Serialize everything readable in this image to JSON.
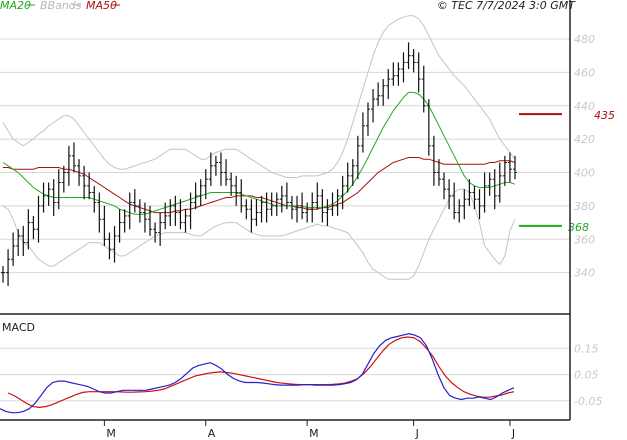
{
  "header": {
    "legend": [
      {
        "label": "MA20",
        "color": "#22aa22"
      },
      {
        "label": "BBands",
        "color": "#b8b8b8"
      },
      {
        "label": "MA50",
        "color": "#aa1111"
      }
    ],
    "source": "© TEC 7/7/2024 3:0 GMT"
  },
  "colors": {
    "price": "#111111",
    "ma20": "#22aa22",
    "ma50": "#aa1111",
    "bbands": "#c4c4c4",
    "macd": "#2222cc",
    "signal": "#cc1111",
    "grid": "#d8d8d8",
    "ytick": "#c8c8c8"
  },
  "chart_data": [
    {
      "type": "line",
      "name": "price",
      "ylim": [
        320,
        495
      ],
      "y_ticks": [
        340,
        360,
        380,
        400,
        420,
        440,
        460,
        480
      ],
      "x_labels": [
        "M",
        "A",
        "M",
        "J",
        "J"
      ],
      "x_label_index": [
        20,
        40,
        60,
        81,
        100
      ],
      "price_close": [
        340,
        348,
        356,
        362,
        358,
        370,
        366,
        380,
        386,
        390,
        382,
        394,
        400,
        410,
        404,
        398,
        392,
        388,
        382,
        372,
        360,
        354,
        362,
        370,
        374,
        382,
        380,
        376,
        372,
        366,
        364,
        370,
        374,
        380,
        376,
        370,
        374,
        382,
        386,
        392,
        396,
        404,
        406,
        400,
        396,
        392,
        388,
        380,
        378,
        372,
        376,
        382,
        378,
        380,
        384,
        386,
        382,
        378,
        380,
        376,
        378,
        382,
        386,
        376,
        378,
        380,
        386,
        392,
        398,
        404,
        416,
        428,
        438,
        444,
        446,
        452,
        456,
        458,
        462,
        466,
        470,
        466,
        456,
        440,
        416,
        400,
        396,
        390,
        386,
        376,
        380,
        384,
        388,
        384,
        380,
        392,
        396,
        386,
        398,
        406,
        402,
        400
      ],
      "resistance": {
        "value": 435,
        "label": "435"
      },
      "support": {
        "value": 368,
        "label": "368"
      },
      "series": [
        {
          "name": "MA20",
          "values": [
            406,
            404,
            402,
            400,
            397,
            394,
            391,
            389,
            387,
            386,
            385,
            385,
            385,
            385,
            385,
            385,
            385,
            385,
            384,
            383,
            382,
            381,
            380,
            378,
            377,
            376,
            375,
            375,
            375,
            376,
            377,
            378,
            379,
            380,
            381,
            382,
            383,
            384,
            385,
            386,
            387,
            388,
            388,
            388,
            388,
            388,
            388,
            387,
            386,
            385,
            384,
            383,
            382,
            381,
            380,
            380,
            380,
            380,
            380,
            380,
            379,
            379,
            379,
            379,
            380,
            381,
            383,
            386,
            389,
            393,
            398,
            403,
            409,
            415,
            421,
            427,
            432,
            437,
            441,
            445,
            448,
            448,
            447,
            444,
            440,
            434,
            428,
            422,
            416,
            410,
            404,
            398,
            394,
            392,
            391,
            391,
            391,
            392,
            393,
            394,
            394,
            393
          ]
        },
        {
          "name": "MA50",
          "values": [
            403,
            403,
            402,
            402,
            402,
            402,
            402,
            403,
            403,
            403,
            403,
            403,
            402,
            402,
            401,
            400,
            399,
            397,
            395,
            393,
            391,
            389,
            387,
            385,
            383,
            381,
            380,
            379,
            378,
            377,
            376,
            376,
            376,
            376,
            377,
            377,
            378,
            378,
            379,
            380,
            381,
            382,
            383,
            384,
            385,
            385,
            386,
            386,
            386,
            386,
            385,
            385,
            384,
            383,
            382,
            381,
            380,
            380,
            379,
            379,
            378,
            378,
            378,
            379,
            379,
            380,
            381,
            382,
            384,
            386,
            388,
            391,
            394,
            397,
            400,
            402,
            404,
            406,
            407,
            408,
            409,
            409,
            409,
            408,
            408,
            407,
            406,
            405,
            405,
            405,
            405,
            405,
            405,
            405,
            405,
            405,
            406,
            406,
            407,
            407,
            407,
            406
          ]
        },
        {
          "name": "Upper band",
          "values": [
            430,
            425,
            420,
            418,
            416,
            418,
            420,
            423,
            425,
            428,
            430,
            432,
            434,
            434,
            432,
            428,
            424,
            420,
            416,
            412,
            408,
            405,
            403,
            402,
            402,
            403,
            404,
            405,
            406,
            407,
            408,
            410,
            412,
            414,
            414,
            414,
            414,
            412,
            410,
            408,
            408,
            410,
            412,
            413,
            414,
            414,
            414,
            412,
            410,
            408,
            406,
            404,
            402,
            400,
            399,
            398,
            397,
            397,
            397,
            398,
            398,
            398,
            398,
            399,
            400,
            402,
            406,
            412,
            420,
            430,
            440,
            450,
            460,
            470,
            478,
            484,
            488,
            490,
            492,
            493,
            494,
            494,
            492,
            488,
            482,
            476,
            470,
            466,
            462,
            458,
            455,
            452,
            448,
            444,
            440,
            436,
            432,
            426,
            420,
            416,
            412,
            408
          ]
        },
        {
          "name": "Lower band",
          "values": [
            380,
            378,
            372,
            364,
            358,
            356,
            352,
            348,
            346,
            344,
            344,
            346,
            348,
            350,
            352,
            354,
            356,
            358,
            358,
            358,
            356,
            354,
            352,
            350,
            350,
            352,
            354,
            356,
            358,
            360,
            362,
            363,
            364,
            364,
            364,
            364,
            364,
            363,
            362,
            362,
            364,
            366,
            368,
            369,
            370,
            370,
            370,
            368,
            366,
            364,
            363,
            362,
            362,
            362,
            362,
            362,
            363,
            364,
            365,
            366,
            367,
            368,
            369,
            368,
            368,
            367,
            366,
            365,
            364,
            360,
            356,
            352,
            346,
            342,
            340,
            338,
            336,
            336,
            336,
            336,
            336,
            338,
            344,
            352,
            360,
            366,
            372,
            378,
            384,
            388,
            390,
            390,
            388,
            380,
            370,
            356,
            352,
            348,
            345,
            350,
            365,
            372
          ]
        }
      ]
    },
    {
      "type": "line",
      "name": "MACD",
      "title": "MACD",
      "ylim": [
        -0.1,
        0.25
      ],
      "y_ticks": [
        -0.05,
        0.05,
        0.15
      ],
      "y_tick_labels": [
        "-0.05",
        "0.05",
        "0.15"
      ],
      "series": [
        {
          "name": "MACD",
          "values": [
            -0.08,
            -0.09,
            -0.095,
            -0.095,
            -0.09,
            -0.08,
            -0.06,
            -0.03,
            0.0,
            0.02,
            0.025,
            0.025,
            0.02,
            0.015,
            0.01,
            0.005,
            -0.005,
            -0.015,
            -0.02,
            -0.02,
            -0.015,
            -0.01,
            -0.01,
            -0.01,
            -0.01,
            -0.01,
            -0.005,
            0.0,
            0.005,
            0.01,
            0.02,
            0.035,
            0.055,
            0.075,
            0.085,
            0.09,
            0.095,
            0.085,
            0.07,
            0.05,
            0.035,
            0.025,
            0.02,
            0.02,
            0.02,
            0.018,
            0.015,
            0.012,
            0.01,
            0.01,
            0.01,
            0.01,
            0.012,
            0.012,
            0.01,
            0.01,
            0.01,
            0.01,
            0.012,
            0.015,
            0.02,
            0.03,
            0.05,
            0.09,
            0.13,
            0.16,
            0.18,
            0.19,
            0.195,
            0.2,
            0.205,
            0.2,
            0.19,
            0.16,
            0.11,
            0.05,
            0.0,
            -0.03,
            -0.04,
            -0.045,
            -0.04,
            -0.04,
            -0.035,
            -0.04,
            -0.045,
            -0.035,
            -0.02,
            -0.01,
            0.0
          ]
        },
        {
          "name": "Signal",
          "values": [
            -0.02,
            -0.03,
            -0.045,
            -0.06,
            -0.072,
            -0.075,
            -0.072,
            -0.065,
            -0.055,
            -0.045,
            -0.035,
            -0.025,
            -0.018,
            -0.015,
            -0.015,
            -0.015,
            -0.015,
            -0.015,
            -0.016,
            -0.017,
            -0.017,
            -0.016,
            -0.015,
            -0.013,
            -0.01,
            -0.005,
            0.005,
            0.015,
            0.025,
            0.035,
            0.045,
            0.05,
            0.055,
            0.058,
            0.06,
            0.058,
            0.055,
            0.05,
            0.045,
            0.04,
            0.035,
            0.03,
            0.025,
            0.02,
            0.017,
            0.015,
            0.013,
            0.012,
            0.012,
            0.012,
            0.012,
            0.012,
            0.013,
            0.015,
            0.018,
            0.025,
            0.035,
            0.055,
            0.08,
            0.11,
            0.14,
            0.165,
            0.18,
            0.19,
            0.193,
            0.19,
            0.175,
            0.15,
            0.12,
            0.08,
            0.045,
            0.02,
            0.0,
            -0.015,
            -0.025,
            -0.032,
            -0.036,
            -0.036,
            -0.032,
            -0.028,
            -0.02,
            -0.015
          ]
        }
      ]
    }
  ]
}
